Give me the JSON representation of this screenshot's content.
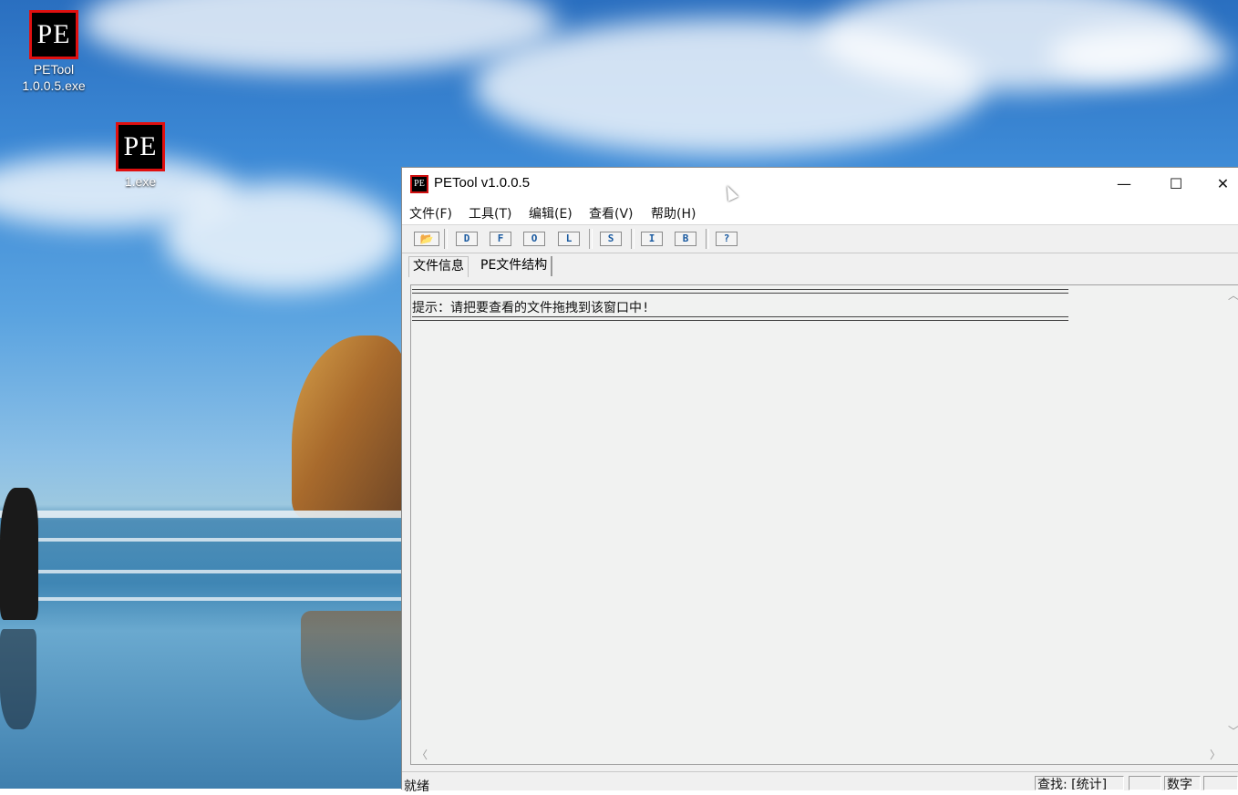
{
  "desktop": {
    "icons": [
      {
        "logo": "PE",
        "label_line1": "PETool",
        "label_line2": "1.0.0.5.exe"
      },
      {
        "logo": "PE",
        "label_line1": "1.exe"
      }
    ]
  },
  "window": {
    "title": "PETool v1.0.0.5",
    "title_icon": "PE",
    "controls": {
      "minimize": "—",
      "maximize": "☐",
      "close": "✕"
    },
    "menu": [
      "文件(F)",
      "工具(T)",
      "编辑(E)",
      "查看(V)",
      "帮助(H)"
    ],
    "toolbar": {
      "open_icon": "📂",
      "buttons": [
        "D",
        "F",
        "O",
        "L",
        "S",
        "I",
        "B",
        "?"
      ]
    },
    "tabs": [
      "文件信息",
      "PE文件结构"
    ],
    "content": {
      "hint": "提示：请把要查看的文件拖拽到该窗口中!"
    },
    "statusbar": {
      "status": "就绪",
      "find": "查找: [统计]",
      "pane_blank": "",
      "num": "数字"
    }
  }
}
